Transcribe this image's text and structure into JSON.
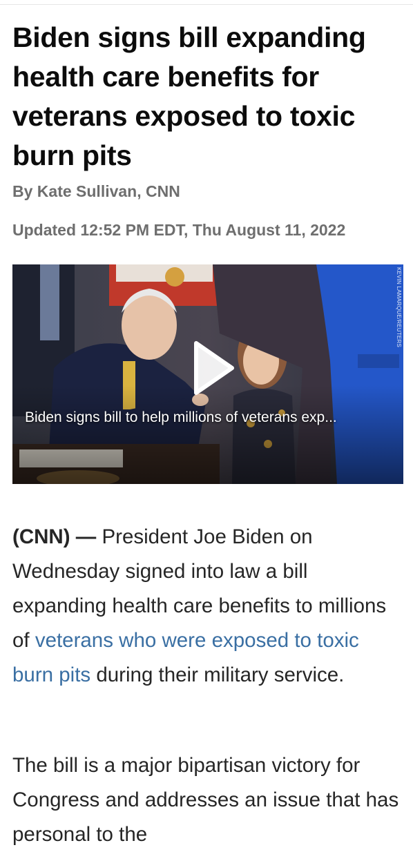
{
  "article": {
    "headline": "Biden signs bill expanding health care benefits for veterans exposed to toxic burn pits",
    "byline": "By Kate Sullivan, CNN",
    "updated": "Updated 12:52 PM EDT, Thu August 11, 2022",
    "video": {
      "caption": "Biden signs bill to help millions of veterans exp...",
      "photo_credit": "KEVIN LAMARQUE/REUTERS",
      "play_icon": "play-icon"
    },
    "paragraphs": [
      {
        "dateline": "(CNN) —",
        "text_before_link": " President Joe Biden on Wednesday signed into law a bill expanding health care benefits to millions of ",
        "link_text": "veterans who were exposed to toxic burn pits",
        "text_after_link": " during their military service."
      },
      {
        "text": "The bill is a major bipartisan victory for Congress and addresses an issue that has personal to the"
      }
    ]
  },
  "colors": {
    "link": "#3a6fa3",
    "meta_text": "#6e6e6e",
    "headline": "#0c0c0c"
  }
}
